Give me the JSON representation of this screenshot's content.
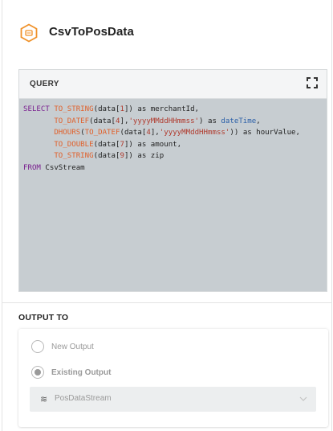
{
  "header": {
    "title": "CsvToPosData",
    "icon": "hexagon-stream-icon",
    "accent_color": "#f0922b"
  },
  "query": {
    "label": "QUERY",
    "lines": [
      [
        {
          "t": "SELECT ",
          "c": "kw"
        },
        {
          "t": "TO_STRING",
          "c": "fn"
        },
        {
          "t": "(data[",
          "c": ""
        },
        {
          "t": "1",
          "c": "str"
        },
        {
          "t": "]) as merchantId,",
          "c": ""
        }
      ],
      [
        {
          "t": "       ",
          "c": ""
        },
        {
          "t": "TO_DATEF",
          "c": "fn"
        },
        {
          "t": "(data[",
          "c": ""
        },
        {
          "t": "4",
          "c": "str"
        },
        {
          "t": "],",
          "c": ""
        },
        {
          "t": "'yyyyMMddHHmmss'",
          "c": "str"
        },
        {
          "t": ") as ",
          "c": ""
        },
        {
          "t": "dateTime",
          "c": "vr"
        },
        {
          "t": ",",
          "c": ""
        }
      ],
      [
        {
          "t": "       ",
          "c": ""
        },
        {
          "t": "DHOURS",
          "c": "fn"
        },
        {
          "t": "(",
          "c": ""
        },
        {
          "t": "TO_DATEF",
          "c": "fn"
        },
        {
          "t": "(data[",
          "c": ""
        },
        {
          "t": "4",
          "c": "str"
        },
        {
          "t": "],",
          "c": ""
        },
        {
          "t": "'yyyyMMddHHmmss'",
          "c": "str"
        },
        {
          "t": ")) as hourValue,",
          "c": ""
        }
      ],
      [
        {
          "t": "       ",
          "c": ""
        },
        {
          "t": "TO_DOUBLE",
          "c": "fn"
        },
        {
          "t": "(data[",
          "c": ""
        },
        {
          "t": "7",
          "c": "str"
        },
        {
          "t": "]) as amount,",
          "c": ""
        }
      ],
      [
        {
          "t": "       ",
          "c": ""
        },
        {
          "t": "TO_STRING",
          "c": "fn"
        },
        {
          "t": "(data[",
          "c": ""
        },
        {
          "t": "9",
          "c": "str"
        },
        {
          "t": "]) as zip",
          "c": ""
        }
      ],
      [
        {
          "t": "FROM",
          "c": "kw"
        },
        {
          "t": " CsvStream",
          "c": ""
        }
      ]
    ]
  },
  "output": {
    "label": "OUTPUT TO",
    "options": [
      {
        "label": "New Output",
        "checked": false
      },
      {
        "label": "Existing Output",
        "checked": true
      }
    ],
    "select": {
      "value": "PosDataStream",
      "icon": "stream-wave-icon"
    }
  }
}
